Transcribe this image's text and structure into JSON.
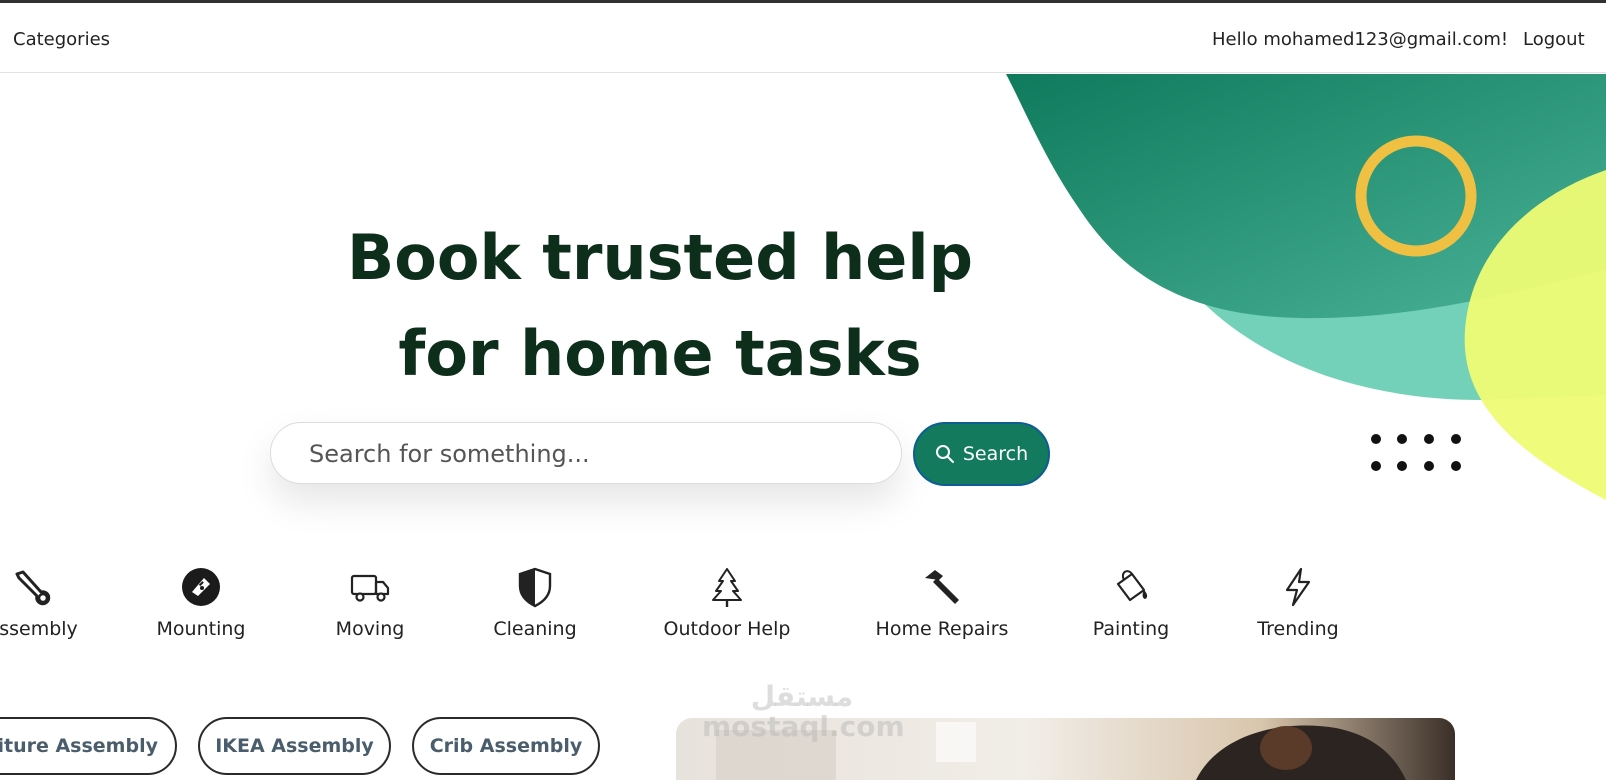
{
  "nav": {
    "categories_label": "Categories",
    "greeting": "Hello mohamed123@gmail.com!",
    "logout_label": "Logout"
  },
  "hero": {
    "title_line1": "Book trusted help",
    "title_line2": "for home tasks",
    "search_placeholder": "Search for something...",
    "search_button": "Search"
  },
  "categories": [
    {
      "label": "Assembly",
      "icon": "wrench-icon"
    },
    {
      "label": "Mounting",
      "icon": "mounting-icon"
    },
    {
      "label": "Moving",
      "icon": "truck-icon"
    },
    {
      "label": "Cleaning",
      "icon": "shield-icon"
    },
    {
      "label": "Outdoor Help",
      "icon": "tree-icon"
    },
    {
      "label": "Home Repairs",
      "icon": "hammer-icon"
    },
    {
      "label": "Painting",
      "icon": "paint-bucket-icon"
    },
    {
      "label": "Trending",
      "icon": "lightning-icon"
    }
  ],
  "subcategories": [
    "Furniture Assembly",
    "IKEA Assembly",
    "Crib Assembly"
  ],
  "watermark": {
    "line1": "مستقل",
    "line2": "mostaql.com"
  },
  "colors": {
    "brand_green": "#137a5e",
    "title_dark_green": "#0c2e1a",
    "accent_yellow": "#f0c043",
    "lime": "#eefc74",
    "mint": "#72d1b8"
  }
}
